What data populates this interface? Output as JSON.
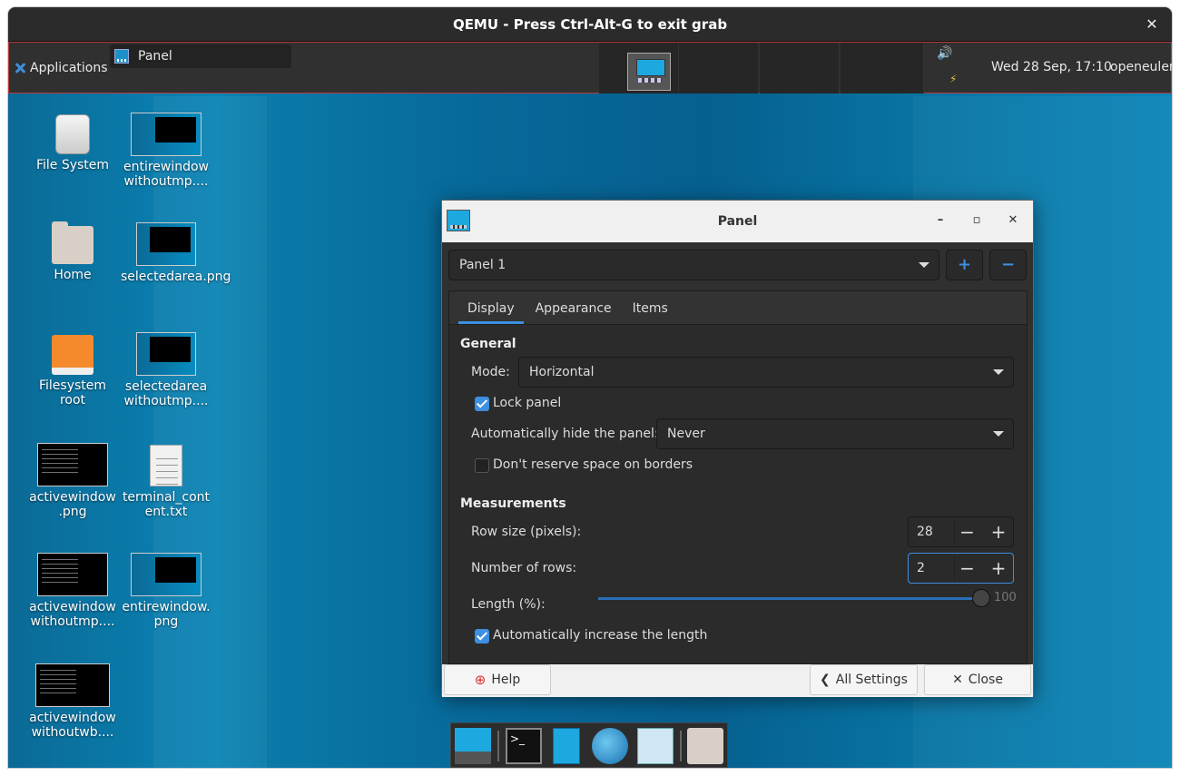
{
  "qemu": {
    "title": "QEMU - Press Ctrl-Alt-G to exit grab",
    "close": "✕"
  },
  "panel": {
    "applications": "Applications",
    "task_label": "Panel",
    "volume_glyph": "🔊",
    "network_glyph": "⚡",
    "clock": "Wed 28 Sep, 17:10",
    "user": "openeuler"
  },
  "desktop_icons": [
    {
      "label": "File System",
      "icon": "drive-harddisk"
    },
    {
      "label": "entirewindow withoutmp....",
      "icon": "image-thumbnail"
    },
    {
      "label": "Home",
      "icon": "folder-home"
    },
    {
      "label": "selectedarea.png",
      "icon": "image-thumbnail"
    },
    {
      "label": "Filesystem root",
      "icon": "drive-orange"
    },
    {
      "label": "selectedarea withoutmp....",
      "icon": "image-thumbnail"
    },
    {
      "label": "activewindow .png",
      "icon": "image-thumbnail"
    },
    {
      "label": "terminal_cont ent.txt",
      "icon": "text-file"
    },
    {
      "label": "activewindow withoutmp....",
      "icon": "image-thumbnail"
    },
    {
      "label": "entirewindow. png",
      "icon": "image-thumbnail"
    },
    {
      "label": "activewindow withoutwb....",
      "icon": "image-thumbnail"
    }
  ],
  "dialog": {
    "title": "Panel",
    "panel_select": "Panel 1",
    "add_glyph": "+",
    "remove_glyph": "−",
    "tabs": [
      "Display",
      "Appearance",
      "Items"
    ],
    "general_header": "General",
    "mode_label": "Mode:",
    "mode_value": "Horizontal",
    "lock_label": "Lock panel",
    "autohide_label": "Automatically hide the panel:",
    "autohide_value": "Never",
    "reserve_label": "Don't reserve space on borders",
    "measurements_header": "Measurements",
    "row_size_label": "Row size (pixels):",
    "row_size_value": "28",
    "rows_label": "Number of rows:",
    "rows_value": "2",
    "length_label": "Length (%):",
    "length_value": "100",
    "length_percent": 100,
    "auto_length_label": "Automatically increase the length",
    "help": "Help",
    "all_settings": "All Settings",
    "close": "Close",
    "lock_checked": true,
    "reserve_checked": false,
    "auto_length_checked": true
  },
  "colors": {
    "accent": "#3d8fe0",
    "desktop": "#0a7aa8",
    "panel_border": "#b43a3a"
  }
}
